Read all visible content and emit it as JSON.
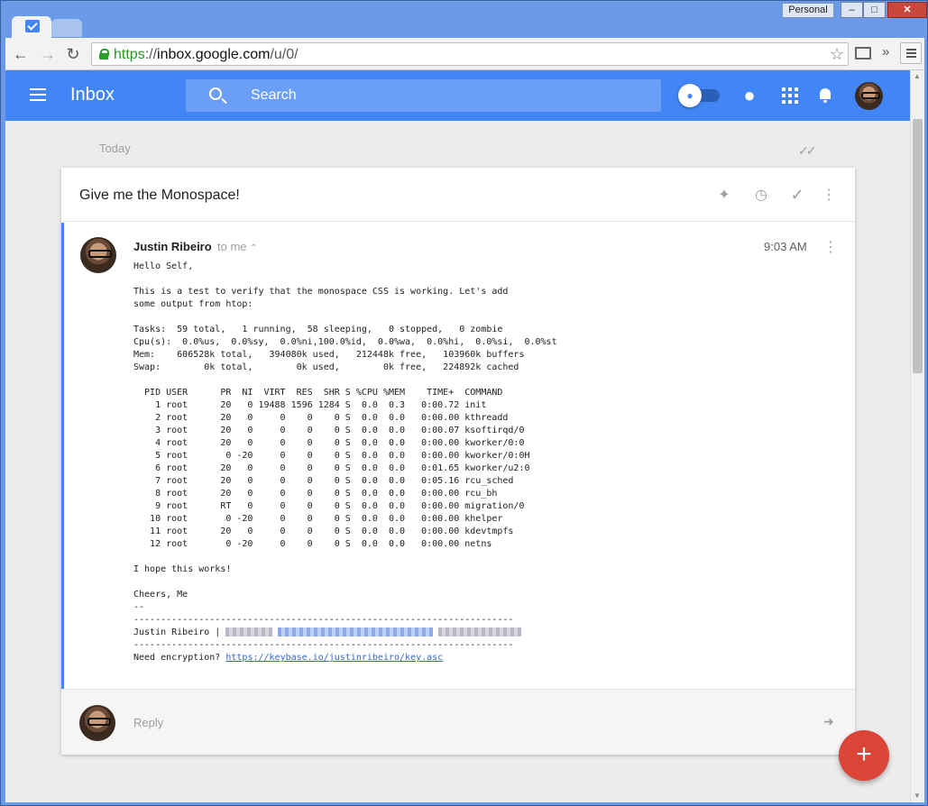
{
  "browser": {
    "profile_label": "Personal",
    "minimize": "–",
    "maximize": "□",
    "close": "✕",
    "back": "←",
    "forward": "→",
    "reload": "↻",
    "url_scheme": "https",
    "url_sep": "://",
    "url_host": "inbox.google.com",
    "url_path": "/u/0/",
    "star": "☆",
    "extensions_overflow": "»"
  },
  "appbar": {
    "title": "Inbox",
    "search_placeholder": "Search",
    "pin_glyph": "📌",
    "accent": "#4285f4"
  },
  "list": {
    "section_label": "Today",
    "sweep_glyph": "✓✓"
  },
  "thread": {
    "subject": "Give me the Monospace!",
    "actions": {
      "pin": "📌",
      "snooze": "◷",
      "done": "✓",
      "more": "⋮"
    },
    "message": {
      "sender": "Justin Ribeiro",
      "recipient_text": "to me",
      "expand": "⌃",
      "time": "9:03 AM",
      "more": "⋮",
      "body_lines": [
        "Hello Self,",
        "",
        "This is a test to verify that the monospace CSS is working. Let's add",
        "some output from htop:",
        "",
        "Tasks:  59 total,   1 running,  58 sleeping,   0 stopped,   0 zombie",
        "Cpu(s):  0.0%us,  0.0%sy,  0.0%ni,100.0%id,  0.0%wa,  0.0%hi,  0.0%si,  0.0%st",
        "Mem:    606528k total,   394080k used,   212448k free,   103960k buffers",
        "Swap:        0k total,        0k used,        0k free,   224892k cached",
        "",
        "  PID USER      PR  NI  VIRT  RES  SHR S %CPU %MEM    TIME+  COMMAND",
        "    1 root      20   0 19488 1596 1284 S  0.0  0.3   0:00.72 init",
        "    2 root      20   0     0    0    0 S  0.0  0.0   0:00.00 kthreadd",
        "    3 root      20   0     0    0    0 S  0.0  0.0   0:00.07 ksoftirqd/0",
        "    4 root      20   0     0    0    0 S  0.0  0.0   0:00.00 kworker/0:0",
        "    5 root       0 -20     0    0    0 S  0.0  0.0   0:00.00 kworker/0:0H",
        "    6 root      20   0     0    0    0 S  0.0  0.0   0:01.65 kworker/u2:0",
        "    7 root      20   0     0    0    0 S  0.0  0.0   0:05.16 rcu_sched",
        "    8 root      20   0     0    0    0 S  0.0  0.0   0:00.00 rcu_bh",
        "    9 root      RT   0     0    0    0 S  0.0  0.0   0:00.00 migration/0",
        "   10 root       0 -20     0    0    0 S  0.0  0.0   0:00.00 khelper",
        "   11 root      20   0     0    0    0 S  0.0  0.0   0:00.00 kdevtmpfs",
        "   12 root       0 -20     0    0    0 S  0.0  0.0   0:00.00 netns",
        "",
        "I hope this works!",
        "",
        "Cheers, Me",
        "--",
        "----------------------------------------------------------------------"
      ],
      "signature_name": "Justin Ribeiro | ",
      "separator": "----------------------------------------------------------------------",
      "encryption_prefix": "Need encryption? ",
      "encryption_link": "https://keybase.io/justinribeiro/key.asc"
    },
    "reply_placeholder": "Reply",
    "forward_glyph": "➜"
  },
  "fab": {
    "label": "+",
    "color": "#db4437"
  }
}
